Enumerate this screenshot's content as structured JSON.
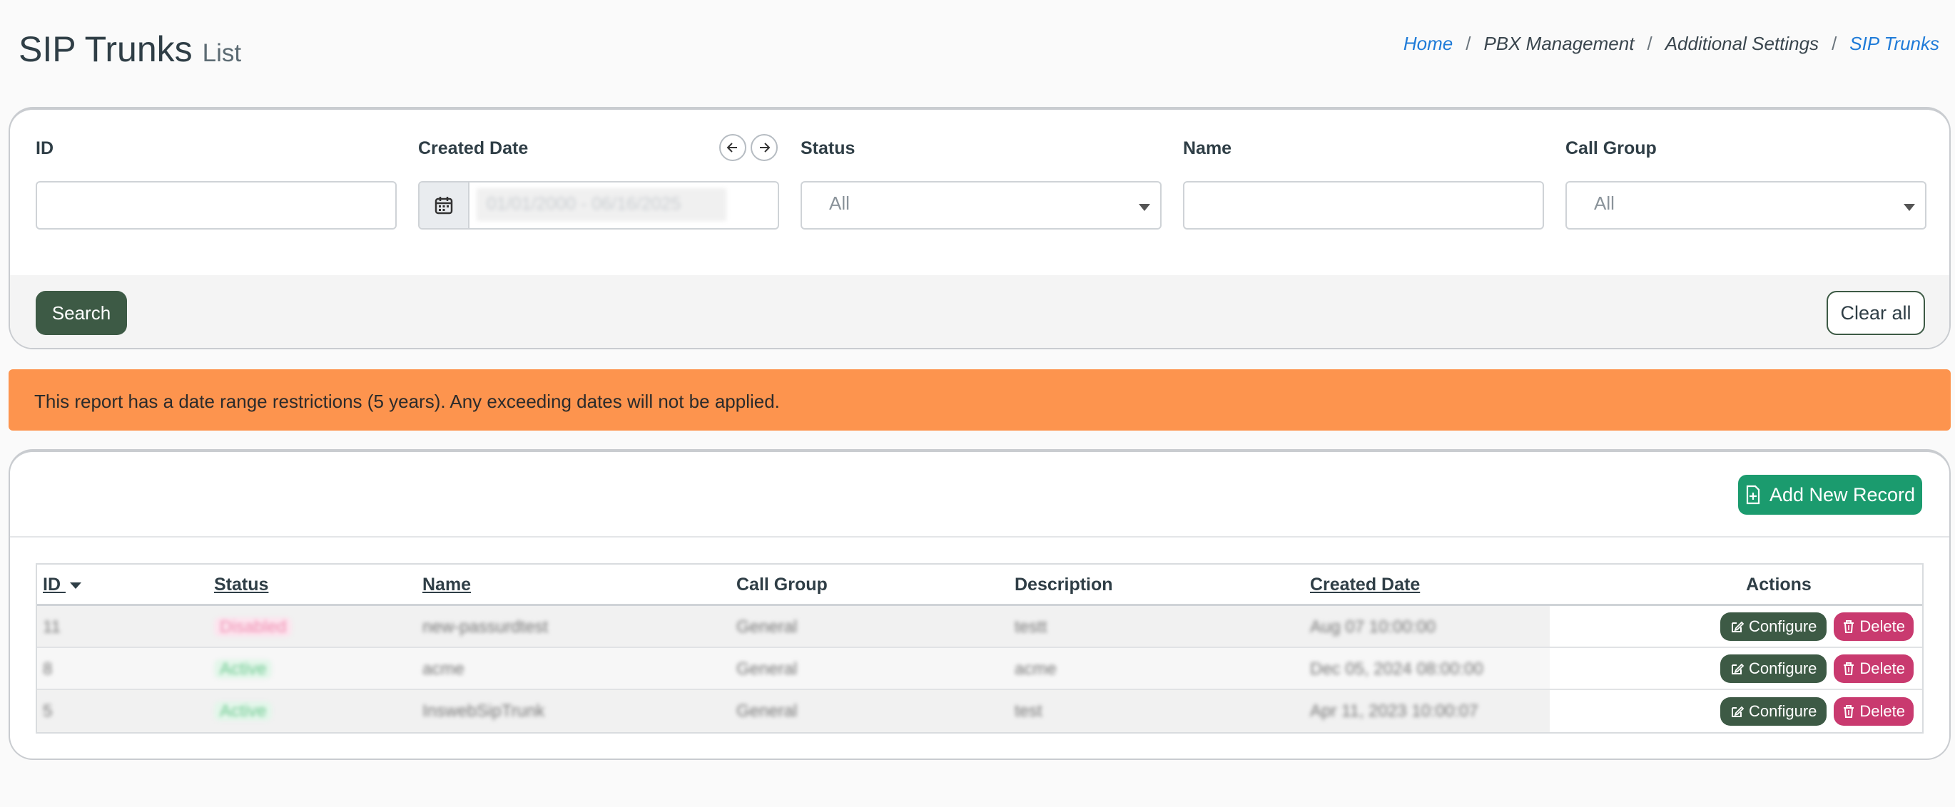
{
  "header": {
    "title": "SIP Trunks",
    "subtitle": "List"
  },
  "breadcrumb": {
    "home": "Home",
    "sep": "/",
    "pbx": "PBX Management",
    "additional": "Additional Settings",
    "current": "SIP Trunks"
  },
  "filters": {
    "id_label": "ID",
    "created_label": "Created Date",
    "created_value": "01/01/2000 - 06/16/2025",
    "status_label": "Status",
    "status_value": "All",
    "name_label": "Name",
    "call_group_label": "Call Group",
    "call_group_value": "All",
    "search_label": "Search",
    "clear_label": "Clear all"
  },
  "alert": {
    "message": "This report has a date range restrictions (5 years). Any exceeding dates will not be applied."
  },
  "table": {
    "add_label": "Add New Record",
    "columns": [
      "ID",
      "Status",
      "Name",
      "Call Group",
      "Description",
      "Created Date",
      "Actions"
    ],
    "rows": [
      {
        "id": "11",
        "status": "Disabled",
        "name": "new-passurdtest",
        "call_group": "General",
        "description": "testt",
        "created": "Aug 07 10:00:00"
      },
      {
        "id": "8",
        "status": "Active",
        "name": "acme",
        "call_group": "General",
        "description": "acme",
        "created": "Dec 05, 2024 08:00:00"
      },
      {
        "id": "5",
        "status": "Active",
        "name": "InswebSipTrunk",
        "call_group": "General",
        "description": "test",
        "created": "Apr 11, 2023 10:00:07"
      }
    ],
    "configure_label": "Configure",
    "delete_label": "Delete"
  },
  "colors": {
    "primary_dark": "#3d5a45",
    "accent_green": "#1b9b6e",
    "delete_pink": "#c93a6f",
    "alert_orange": "#fd944e",
    "link_blue": "#1f7bd8"
  }
}
